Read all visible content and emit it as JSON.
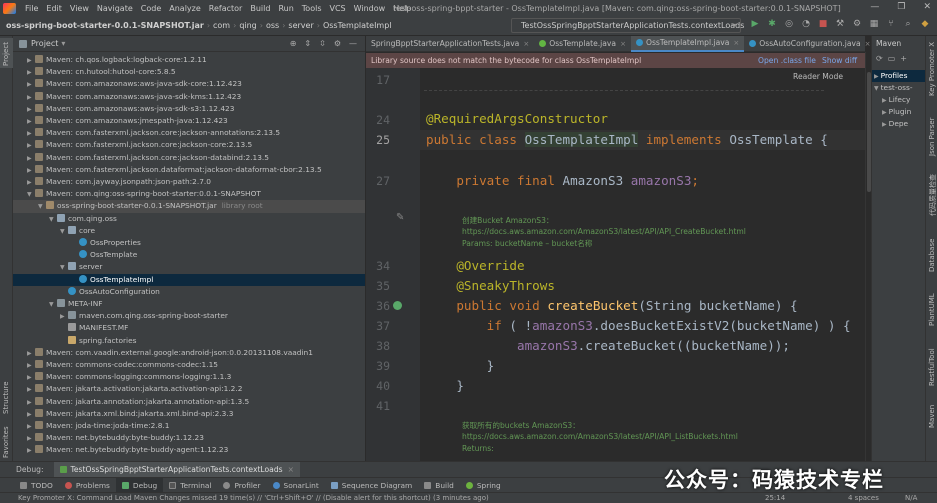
{
  "menu": [
    "File",
    "Edit",
    "View",
    "Navigate",
    "Code",
    "Analyze",
    "Refactor",
    "Build",
    "Run",
    "Tools",
    "VCS",
    "Window",
    "Help"
  ],
  "window_title": "test-oss-spring-bppt-starter - OssTemplateImpl.java [Maven: com.qing:oss-spring-boot-starter:0.0.1-SNAPSHOT]",
  "breadcrumbs": [
    "oss-spring-boot-starter-0.0.1-SNAPSHOT.jar",
    "com",
    "qing",
    "oss",
    "server",
    "OssTemplateImpl"
  ],
  "run_config": "TestOssSpringBpptStarterApplicationTests.contextLoads",
  "project": {
    "header": "Project",
    "rows": [
      {
        "indent": 1,
        "arrow": "▶",
        "icon": "mvn",
        "label": "Maven: ch.qos.logback:logback-core:1.2.11"
      },
      {
        "indent": 1,
        "arrow": "▶",
        "icon": "mvn",
        "label": "Maven: cn.hutool:hutool-core:5.8.5"
      },
      {
        "indent": 1,
        "arrow": "▶",
        "icon": "mvn",
        "label": "Maven: com.amazonaws:aws-java-sdk-core:1.12.423"
      },
      {
        "indent": 1,
        "arrow": "▶",
        "icon": "mvn",
        "label": "Maven: com.amazonaws:aws-java-sdk-kms:1.12.423"
      },
      {
        "indent": 1,
        "arrow": "▶",
        "icon": "mvn",
        "label": "Maven: com.amazonaws:aws-java-sdk-s3:1.12.423"
      },
      {
        "indent": 1,
        "arrow": "▶",
        "icon": "mvn",
        "label": "Maven: com.amazonaws:jmespath-java:1.12.423"
      },
      {
        "indent": 1,
        "arrow": "▶",
        "icon": "mvn",
        "label": "Maven: com.fasterxml.jackson.core:jackson-annotations:2.13.5"
      },
      {
        "indent": 1,
        "arrow": "▶",
        "icon": "mvn",
        "label": "Maven: com.fasterxml.jackson.core:jackson-core:2.13.5"
      },
      {
        "indent": 1,
        "arrow": "▶",
        "icon": "mvn",
        "label": "Maven: com.fasterxml.jackson.core:jackson-databind:2.13.5"
      },
      {
        "indent": 1,
        "arrow": "▶",
        "icon": "mvn",
        "label": "Maven: com.fasterxml.jackson.dataformat:jackson-dataformat-cbor:2.13.5"
      },
      {
        "indent": 1,
        "arrow": "▶",
        "icon": "mvn",
        "label": "Maven: com.jayway.jsonpath:json-path:2.7.0"
      },
      {
        "indent": 1,
        "arrow": "▼",
        "icon": "mvn",
        "label": "Maven: com.qing:oss-spring-boot-starter:0.0.1-SNAPSHOT"
      },
      {
        "indent": 2,
        "arrow": "▼",
        "icon": "jar",
        "label": "oss-spring-boot-starter-0.0.1-SNAPSHOT.jar",
        "dim": "library root",
        "hl": true
      },
      {
        "indent": 3,
        "arrow": "▼",
        "icon": "pkg",
        "label": "com.qing.oss"
      },
      {
        "indent": 4,
        "arrow": "▼",
        "icon": "pkg",
        "label": "core"
      },
      {
        "indent": 5,
        "arrow": "",
        "icon": "cls",
        "label": "OssProperties"
      },
      {
        "indent": 5,
        "arrow": "",
        "icon": "cls",
        "label": "OssTemplate"
      },
      {
        "indent": 4,
        "arrow": "▼",
        "icon": "pkg",
        "label": "server"
      },
      {
        "indent": 5,
        "arrow": "",
        "icon": "cls",
        "label": "OssTemplateImpl",
        "sel": true
      },
      {
        "indent": 4,
        "arrow": "",
        "icon": "cls",
        "label": "OssAutoConfiguration"
      },
      {
        "indent": 3,
        "arrow": "▼",
        "icon": "fold",
        "label": "META-INF"
      },
      {
        "indent": 4,
        "arrow": "▶",
        "icon": "fold",
        "label": "maven.com.qing.oss-spring-boot-starter"
      },
      {
        "indent": 4,
        "arrow": "",
        "icon": "mf",
        "label": "MANIFEST.MF"
      },
      {
        "indent": 4,
        "arrow": "",
        "icon": "fac",
        "label": "spring.factories"
      },
      {
        "indent": 1,
        "arrow": "▶",
        "icon": "mvn",
        "label": "Maven: com.vaadin.external.google:android-json:0.0.20131108.vaadin1"
      },
      {
        "indent": 1,
        "arrow": "▶",
        "icon": "mvn",
        "label": "Maven: commons-codec:commons-codec:1.15"
      },
      {
        "indent": 1,
        "arrow": "▶",
        "icon": "mvn",
        "label": "Maven: commons-logging:commons-logging:1.1.3"
      },
      {
        "indent": 1,
        "arrow": "▶",
        "icon": "mvn",
        "label": "Maven: jakarta.activation:jakarta.activation-api:1.2.2"
      },
      {
        "indent": 1,
        "arrow": "▶",
        "icon": "mvn",
        "label": "Maven: jakarta.annotation:jakarta.annotation-api:1.3.5"
      },
      {
        "indent": 1,
        "arrow": "▶",
        "icon": "mvn",
        "label": "Maven: jakarta.xml.bind:jakarta.xml.bind-api:2.3.3"
      },
      {
        "indent": 1,
        "arrow": "▶",
        "icon": "mvn",
        "label": "Maven: joda-time:joda-time:2.8.1"
      },
      {
        "indent": 1,
        "arrow": "▶",
        "icon": "mvn",
        "label": "Maven: net.bytebuddy:byte-buddy:1.12.23"
      },
      {
        "indent": 1,
        "arrow": "▶",
        "icon": "mvn",
        "label": "Maven: net.bytebuddy:byte-buddy-agent:1.12.23"
      }
    ]
  },
  "editor_tabs": [
    {
      "label": "SpringBpptStarterApplicationTests.java",
      "active": false
    },
    {
      "label": "OssTemplate.java",
      "active": false
    },
    {
      "label": "OssTemplateImpl.java",
      "active": true
    },
    {
      "label": "OssAutoConfiguration.java",
      "active": false
    }
  ],
  "warning": {
    "text": "Library source does not match the bytecode for class OssTemplateImpl",
    "open_class_file": "Open .class file",
    "show_diff": "Show diff"
  },
  "reader_mode": "Reader Mode",
  "line_numbers": [
    "17",
    "24",
    "25",
    "27",
    "34",
    "35",
    "36",
    "37",
    "38",
    "39",
    "40",
    "41"
  ],
  "code": {
    "l24": "@RequiredArgsConstructor",
    "l25_kw": "public class ",
    "l25_name": "OssTemplateImpl",
    "l25_impl": " implements ",
    "l25_iface": "OssTemplate {",
    "l27_kw": "private final ",
    "l27_type": "AmazonS3 ",
    "l27_field": "amazonS3",
    "l27_end": ";",
    "doc1": "创建Bucket AmazonS3：https://docs.aws.amazon.com/AmazonS3/latest/API/API_CreateBucket.html",
    "doc1_params": "Params: bucketName – bucket名称",
    "l34": "@Override",
    "l35": "@SneakyThrows",
    "l36_kw": "public void ",
    "l36_fn": "createBucket",
    "l36_rest": "(String bucketName) {",
    "l37_kw": "if ",
    "l37_a": "( !",
    "l37_field": "amazonS3",
    "l37_b": ".doesBucketExistV2(bucketName) ) {",
    "l38_field": "amazonS3",
    "l38_rest": ".createBucket((bucketName));",
    "l39": "}",
    "l40": "}",
    "doc2": "获取所有的buckets AmazonS3：https://docs.aws.amazon.com/AmazonS3/latest/API/API_ListBuckets.html",
    "doc2_ret": "Returns:"
  },
  "maven": {
    "header": "Maven",
    "rows": [
      {
        "label": "Profiles",
        "sel": true
      },
      {
        "label": "test-oss-"
      },
      {
        "label": "Lifecy"
      },
      {
        "label": "Plugin"
      },
      {
        "label": "Depe"
      }
    ]
  },
  "right_stripe": [
    "Key Promoter X",
    "Json Parser",
    "代码质量检查",
    "Database",
    "PlantUML",
    "RestfulTool",
    "Maven"
  ],
  "left_stripe": [
    "Project",
    "Structure",
    "Favorites"
  ],
  "debug": {
    "label": "Debug:",
    "tab": "TestOssSpringBpptStarterApplicationTests.contextLoads"
  },
  "tool_tabs": [
    "TODO",
    "Problems",
    "Debug",
    "Terminal",
    "Profiler",
    "SonarLint",
    "Sequence Diagram",
    "Build",
    "Spring"
  ],
  "status": {
    "message": "Key Promoter X: Command Load Maven Changes missed 19 time(s) // 'Ctrl+Shift+O' // (Disable alert for this shortcut) (3 minutes ago)",
    "position": "25:14",
    "indent": "4 spaces",
    "extra": "N/A"
  },
  "watermark": "公众号：码猿技术专栏"
}
